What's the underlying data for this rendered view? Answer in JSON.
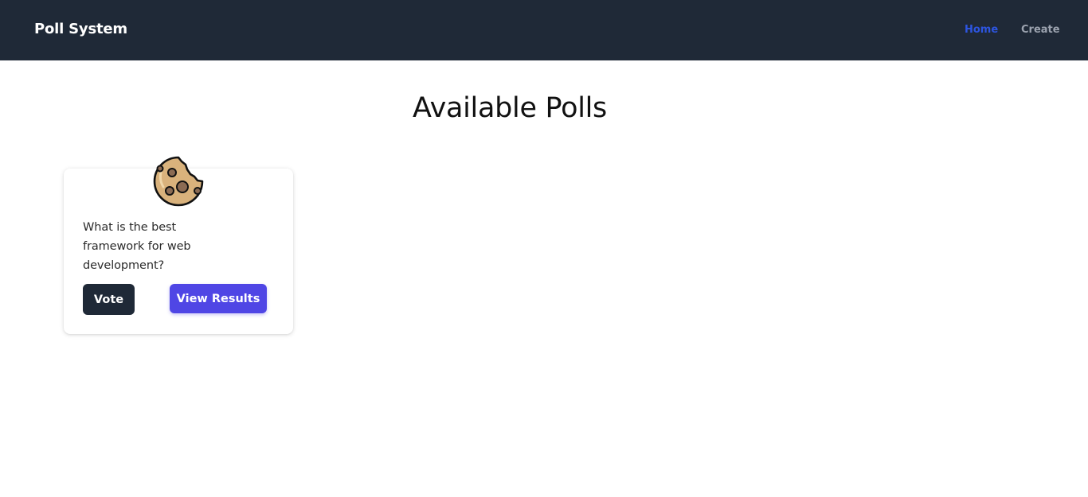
{
  "navbar": {
    "brand": "Poll System",
    "links": [
      {
        "label": "Home",
        "active": true
      },
      {
        "label": "Create",
        "active": false
      }
    ]
  },
  "main": {
    "title": "Available Polls",
    "polls": [
      {
        "icon": "cookie-icon",
        "question": "What is the best framework for web development?",
        "vote_label": "Vote",
        "results_label": "View Results"
      }
    ]
  },
  "colors": {
    "navbar_bg": "#1f2937",
    "active_link": "#2d55e0",
    "inactive_link": "#9ca3af",
    "vote_button": "#1f2937",
    "results_button": "#4f46e5"
  }
}
